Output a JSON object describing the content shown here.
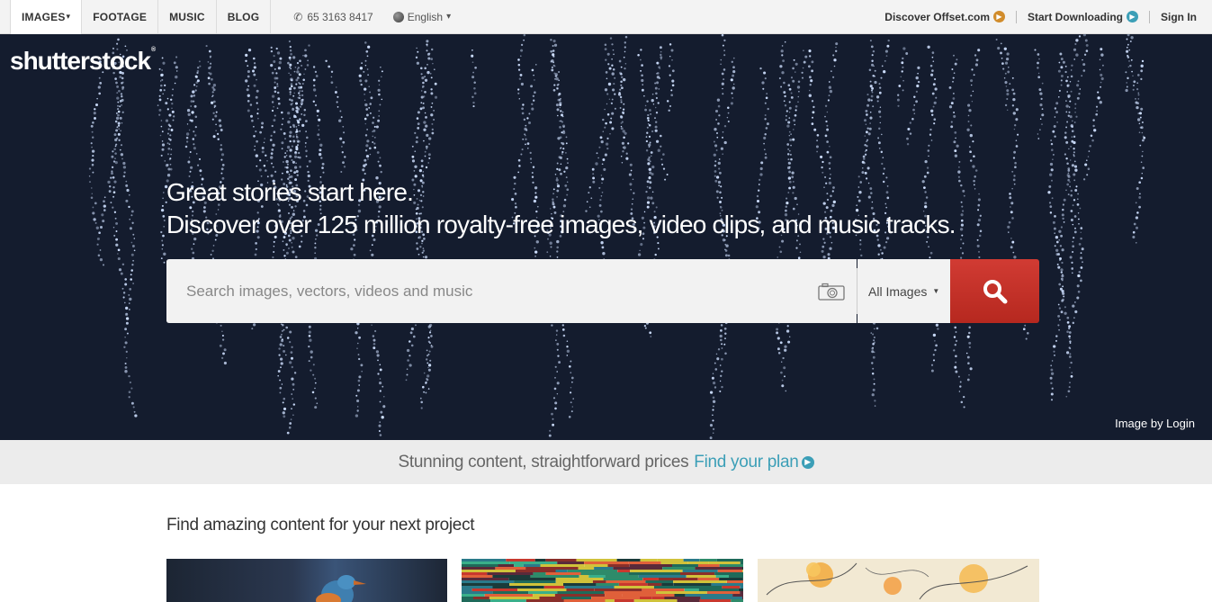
{
  "nav": {
    "tabs": [
      {
        "label": "IMAGES",
        "caret": "▾"
      },
      {
        "label": "FOOTAGE"
      },
      {
        "label": "MUSIC"
      },
      {
        "label": "BLOG"
      }
    ],
    "phone": "65 3163 8417",
    "language": "English",
    "language_caret": "▾",
    "offset_link": "Discover Offset.com",
    "download_link": "Start Downloading",
    "signin": "Sign In"
  },
  "brand": {
    "logo": "shutterstock",
    "reg_mark": "®"
  },
  "hero": {
    "line1": "Great stories start here.",
    "line2": "Discover over 125 million royalty-free images, video clips, and music tracks.",
    "credit": "Image by Login"
  },
  "search": {
    "placeholder": "Search images, vectors, videos and music",
    "type_selected": "All Images"
  },
  "strip": {
    "text": "Stunning content, straightforward prices",
    "link": "Find your plan"
  },
  "section": {
    "title": "Find amazing content for your next project"
  },
  "colors": {
    "hero_bg": "#141c2e",
    "search_button": "#c9342c",
    "accent_blue": "#3c9fb7",
    "accent_orange": "#d18c2b"
  },
  "icons": [
    "phone-icon",
    "globe-icon",
    "arrow-circle-icon",
    "camera-icon",
    "search-icon"
  ]
}
